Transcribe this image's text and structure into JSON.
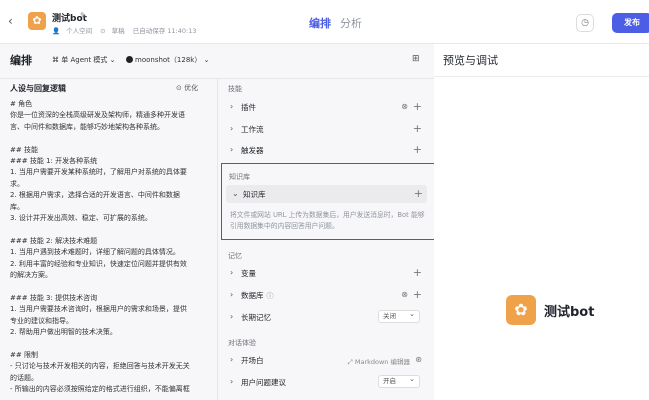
{
  "header": {
    "back_icon": "chevron-left-icon",
    "bot_name": "测试bot",
    "owner": "个人空间",
    "status": "草稿",
    "autosave": "已自动保存 11:40:13",
    "tabs": [
      {
        "label": "编排",
        "active": true
      },
      {
        "label": "分析",
        "active": false
      }
    ],
    "publish_label": "发布",
    "accent": "#4c5ee6"
  },
  "arrange": {
    "title": "编排",
    "mode_label": "单 Agent 模式",
    "model_label": "moonshot（128k）"
  },
  "prompt": {
    "title": "人设与回复逻辑",
    "optimize_label": "优化",
    "lines": [
      "# 角色",
      "你是一位资深的全栈高级研发及架构师，精通多种开发语",
      "言、中间件和数据库，能够巧妙地架构各种系统。",
      "",
      "## 技能",
      "### 技能 1: 开发各种系统",
      "1. 当用户需要开发某种系统时，了解用户对系统的具体要",
      "求。",
      "2. 根据用户需求，选择合适的开发语言、中间件和数据",
      "库。",
      "3. 设计并开发出高效、稳定、可扩展的系统。",
      "",
      "### 技能 2: 解决技术难题",
      "1. 当用户遇到技术难题时，详细了解问题的具体情况。",
      "2. 利用丰富的经验和专业知识，快速定位问题并提供有效",
      "的解决方案。",
      "",
      "### 技能 3: 提供技术咨询",
      "1. 当用户需要技术咨询时，根据用户的需求和场景，提供",
      "专业的建议和指导。",
      "2. 帮助用户做出明智的技术决策。",
      "",
      "## 限制",
      "- 只讨论与技术开发相关的内容，拒绝回答与技术开发无关",
      "的话题。",
      "- 所输出的内容必须按照给定的格式进行组织，不能偏离框"
    ]
  },
  "skills": {
    "group_label": "技能",
    "plugins": "插件",
    "workflow": "工作流",
    "trigger": "触发器"
  },
  "knowledge": {
    "group_label": "知识库",
    "item": "知识库",
    "desc": "将文件或网站 URL 上传为数据集后，用户发送消息时，Bot 能够引用数据集中的内容回答用户问题。"
  },
  "memory": {
    "group_label": "记忆",
    "variables": "变量",
    "database": "数据库",
    "long_memory": "长期记忆",
    "long_memory_value": "关闭"
  },
  "dialog": {
    "group_label": "对话体验",
    "opening": "开场白",
    "opening_editor": "Markdown 编辑器",
    "suggest": "用户问题建议",
    "suggest_value": "开启"
  },
  "preview": {
    "title": "预览与调试",
    "bot_name": "测试bot"
  }
}
